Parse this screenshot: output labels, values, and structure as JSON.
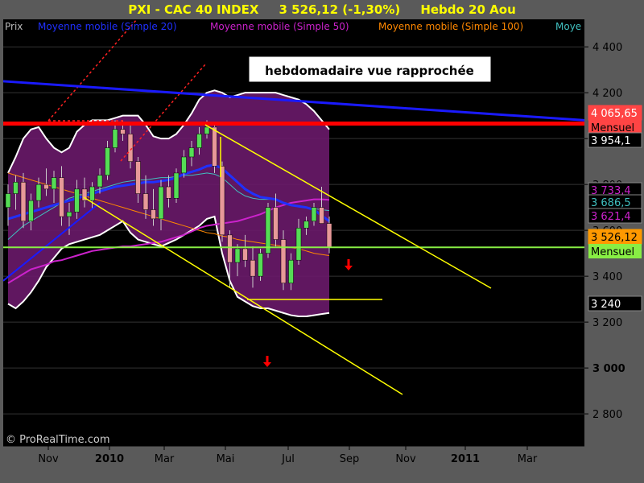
{
  "title": {
    "main": "PXI - CAC 40 INDEX",
    "price": "3 526,12 (-1,30%)",
    "period": "Hebdo  20 Aou"
  },
  "legend": {
    "prix": "Prix",
    "ma20": "Moyenne mobile (Simple 20)",
    "ma50": "Moyenne mobile (Simple 50)",
    "ma100": "Moyenne mobile (Simple 100)",
    "more": "Moye"
  },
  "annotation": "hebdomadaire vue rapprochée",
  "watermark": "© ProRealTime.com",
  "colors": {
    "bg_plot": "#000000",
    "bg_frame": "#5a5a5a",
    "title": "#ffff00",
    "candle_up": "#55dd55",
    "candle_down": "#e89999",
    "bollinger_fill": "#6a1a6a",
    "ma20": "#2030ff",
    "ma50": "#cc22cc",
    "ma100": "#ff8800",
    "teal": "#40c0c0",
    "resistance": "#ff0000",
    "support": "#88ee44",
    "channel": "#ffff00",
    "trend": "#1a1aff"
  },
  "chart_data": {
    "type": "candlestick",
    "x_axis_labels": [
      "Nov",
      "2010",
      "Mar",
      "Mai",
      "Jul",
      "Sep",
      "Nov",
      "2011",
      "Mar"
    ],
    "y_axis": {
      "ylim": [
        2660,
        4520
      ],
      "ticks": [
        2800,
        3000,
        3200,
        3400,
        3600,
        3800,
        4000,
        4200,
        4400
      ],
      "tick_labels": [
        "2 800",
        "3 000",
        "3 200",
        "3 400",
        "3 600",
        "3 800",
        "4 000",
        "4 200",
        "4 400"
      ]
    },
    "price_boxes": [
      {
        "value": 4065.65,
        "label": "4 065,65",
        "sub": "Mensuel",
        "bg": "#ff4444",
        "fg": "#ffffff"
      },
      {
        "value": 3954.1,
        "label": "3 954,1",
        "bg": "#000000",
        "fg": "#ffffff"
      },
      {
        "value": 3733.4,
        "label": "3 733,4",
        "bg": "#000000",
        "fg": "#cc22cc"
      },
      {
        "value": 3686.5,
        "label": "3 686,5",
        "bg": "#000000",
        "fg": "#40c0c0"
      },
      {
        "value": 3621.4,
        "label": "3 621,4",
        "bg": "#000000",
        "fg": "#cc22cc"
      },
      {
        "value": 3526.12,
        "label": "3 526,12",
        "sub": "Mensuel",
        "bg": "#ff9900",
        "fg": "#000000",
        "sub_bg": "#88ee44"
      },
      {
        "value": 3240,
        "label": "3 240",
        "bg": "#000000",
        "fg": "#ffffff"
      }
    ],
    "weeks": 43,
    "ohlc": [
      [
        3700,
        3800,
        3620,
        3760
      ],
      [
        3760,
        3840,
        3690,
        3810
      ],
      [
        3810,
        3850,
        3610,
        3640
      ],
      [
        3640,
        3760,
        3600,
        3730
      ],
      [
        3730,
        3830,
        3700,
        3800
      ],
      [
        3800,
        3870,
        3750,
        3780
      ],
      [
        3780,
        3860,
        3720,
        3830
      ],
      [
        3830,
        3880,
        3620,
        3660
      ],
      [
        3660,
        3720,
        3580,
        3680
      ],
      [
        3680,
        3820,
        3650,
        3780
      ],
      [
        3780,
        3830,
        3700,
        3730
      ],
      [
        3730,
        3810,
        3690,
        3790
      ],
      [
        3790,
        3870,
        3760,
        3840
      ],
      [
        3840,
        3990,
        3820,
        3960
      ],
      [
        3960,
        4080,
        3940,
        4040
      ],
      [
        4040,
        4080,
        3990,
        4020
      ],
      [
        4020,
        4060,
        3870,
        3900
      ],
      [
        3900,
        3920,
        3720,
        3760
      ],
      [
        3760,
        3840,
        3650,
        3690
      ],
      [
        3690,
        3780,
        3620,
        3650
      ],
      [
        3650,
        3820,
        3600,
        3790
      ],
      [
        3790,
        3840,
        3700,
        3740
      ],
      [
        3740,
        3870,
        3720,
        3850
      ],
      [
        3850,
        3950,
        3830,
        3920
      ],
      [
        3920,
        3990,
        3880,
        3960
      ],
      [
        3960,
        4050,
        3930,
        4020
      ],
      [
        4020,
        4080,
        4000,
        4050
      ],
      [
        4050,
        4070,
        3850,
        3880
      ],
      [
        3880,
        3900,
        3550,
        3580
      ],
      [
        3580,
        3600,
        3350,
        3460
      ],
      [
        3460,
        3540,
        3400,
        3520
      ],
      [
        3520,
        3580,
        3440,
        3470
      ],
      [
        3470,
        3530,
        3350,
        3400
      ],
      [
        3400,
        3520,
        3380,
        3500
      ],
      [
        3500,
        3720,
        3480,
        3700
      ],
      [
        3700,
        3760,
        3530,
        3560
      ],
      [
        3560,
        3600,
        3340,
        3370
      ],
      [
        3370,
        3500,
        3340,
        3470
      ],
      [
        3470,
        3650,
        3450,
        3610
      ],
      [
        3610,
        3660,
        3580,
        3640
      ],
      [
        3640,
        3720,
        3620,
        3700
      ],
      [
        3700,
        3790,
        3650,
        3630
      ],
      [
        3630,
        3660,
        3500,
        3526
      ]
    ],
    "ma20": [
      3650,
      3660,
      3670,
      3680,
      3690,
      3700,
      3710,
      3720,
      3730,
      3740,
      3750,
      3760,
      3770,
      3780,
      3790,
      3795,
      3800,
      3805,
      3810,
      3810,
      3815,
      3820,
      3830,
      3845,
      3855,
      3865,
      3880,
      3885,
      3870,
      3840,
      3810,
      3780,
      3760,
      3745,
      3740,
      3735,
      3720,
      3710,
      3705,
      3700,
      3690,
      3665,
      3640
    ],
    "ma50": [
      3370,
      3390,
      3410,
      3430,
      3440,
      3450,
      3465,
      3470,
      3480,
      3490,
      3500,
      3510,
      3515,
      3520,
      3525,
      3530,
      3530,
      3535,
      3540,
      3545,
      3550,
      3560,
      3570,
      3580,
      3595,
      3610,
      3620,
      3625,
      3630,
      3635,
      3640,
      3650,
      3660,
      3670,
      3685,
      3700,
      3710,
      3720,
      3725,
      3730,
      3735,
      3735,
      3733
    ],
    "ma100": [
      3850,
      3840,
      3830,
      3820,
      3810,
      3800,
      3790,
      3780,
      3770,
      3760,
      3750,
      3740,
      3730,
      3720,
      3710,
      3700,
      3690,
      3680,
      3670,
      3660,
      3650,
      3640,
      3630,
      3620,
      3610,
      3600,
      3590,
      3585,
      3575,
      3570,
      3560,
      3555,
      3550,
      3545,
      3540,
      3535,
      3530,
      3525,
      3520,
      3510,
      3500,
      3495,
      3490
    ],
    "teal_ma": [
      3560,
      3590,
      3620,
      3640,
      3660,
      3680,
      3700,
      3720,
      3740,
      3750,
      3760,
      3770,
      3780,
      3790,
      3800,
      3810,
      3815,
      3820,
      3820,
      3825,
      3830,
      3830,
      3835,
      3840,
      3840,
      3845,
      3850,
      3845,
      3830,
      3800,
      3770,
      3750,
      3740,
      3735,
      3735,
      3735,
      3720,
      3710,
      3705,
      3700,
      3695,
      3690,
      3686
    ],
    "boll_upper": [
      3850,
      3920,
      4000,
      4040,
      4050,
      4000,
      3960,
      3940,
      3960,
      4030,
      4060,
      4080,
      4080,
      4080,
      4090,
      4100,
      4100,
      4100,
      4060,
      4010,
      4000,
      4000,
      4020,
      4060,
      4110,
      4170,
      4200,
      4210,
      4200,
      4180,
      4190,
      4200,
      4200,
      4200,
      4200,
      4200,
      4190,
      4180,
      4170,
      4150,
      4120,
      4080,
      4040
    ],
    "boll_lower": [
      3280,
      3260,
      3290,
      3330,
      3380,
      3440,
      3480,
      3520,
      3540,
      3550,
      3560,
      3570,
      3580,
      3600,
      3620,
      3640,
      3590,
      3560,
      3550,
      3540,
      3530,
      3545,
      3560,
      3580,
      3600,
      3620,
      3650,
      3660,
      3500,
      3380,
      3310,
      3290,
      3270,
      3260,
      3260,
      3250,
      3240,
      3230,
      3225,
      3225,
      3230,
      3235,
      3240
    ],
    "lines": {
      "resistance": 4065.65,
      "support": 3526.12,
      "trend_blue": {
        "from": [
          0,
          4250
        ],
        "to": [
          54,
          4080
        ]
      },
      "channel_upper": {
        "from": [
          27.5,
          4060
        ],
        "to": [
          45,
          3370
        ]
      },
      "channel_lower": {
        "from": [
          11,
          3780
        ],
        "to": [
          37,
          2850
        ]
      },
      "base_segment": {
        "from": [
          33,
          3290
        ],
        "to": [
          47,
          3290
        ]
      }
    },
    "markers": [
      {
        "x": 50,
        "y": 3480,
        "type": "down-arrow",
        "color": "#ff0000"
      },
      {
        "x": 39,
        "y": 3000,
        "type": "down-arrow",
        "color": "#ff0000"
      }
    ]
  }
}
